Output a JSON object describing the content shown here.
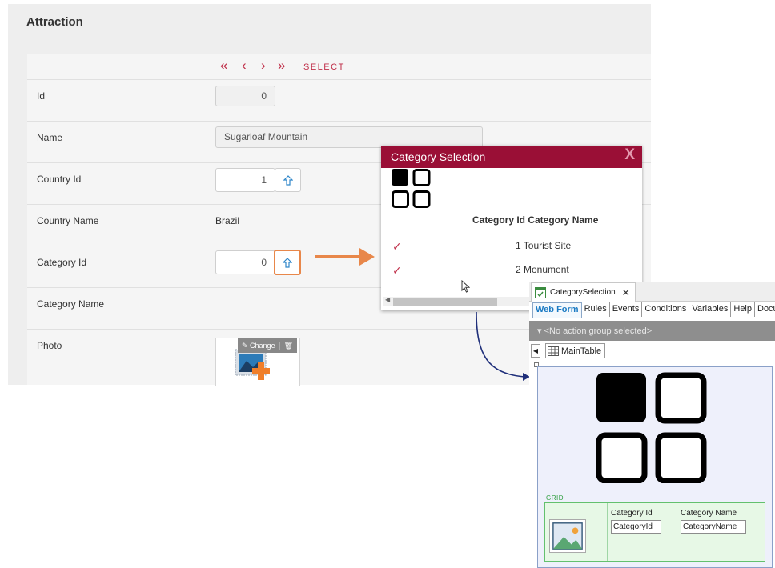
{
  "form": {
    "title": "Attraction",
    "nav": {
      "first": "«",
      "prev": "‹",
      "next": "›",
      "last": "»",
      "select": "SELECT"
    },
    "fields": {
      "id": {
        "label": "Id",
        "value": "0"
      },
      "name": {
        "label": "Name",
        "value": "Sugarloaf Mountain"
      },
      "country_id": {
        "label": "Country Id",
        "value": "1"
      },
      "country_name": {
        "label": "Country Name",
        "value": "Brazil"
      },
      "category_id": {
        "label": "Category Id",
        "value": "0"
      },
      "category_name": {
        "label": "Category Name",
        "value": ""
      },
      "photo": {
        "label": "Photo",
        "change_label": "✎ Change",
        "delete_label": "🗑"
      }
    }
  },
  "popup": {
    "title": "Category Selection",
    "close": "X",
    "column_header": "Category Id Category Name",
    "rows": [
      {
        "check": "✓",
        "value": "1 Tourist Site"
      },
      {
        "check": "✓",
        "value": "2 Monument"
      }
    ],
    "scroll_left": "◀"
  },
  "ide": {
    "tab": {
      "title": "CategorySelection",
      "close": "✕"
    },
    "subtabs": [
      "Web Form",
      "Rules",
      "Events",
      "Conditions",
      "Variables",
      "Help",
      "Docu"
    ],
    "action_group": "▾  <No action group selected>",
    "crumb_arrow": "◀",
    "crumb": "MainTable",
    "grid": {
      "label": "GRID",
      "columns": [
        {
          "header": "Category Id",
          "field": "CategoryId"
        },
        {
          "header": "Category Name",
          "field": "CategoryName"
        }
      ]
    }
  },
  "colors": {
    "accent": "#9a0f36",
    "nav": "#c0304a",
    "highlight": "#e8874a",
    "connector": "#1f2f7a",
    "grid_border": "#63c06e"
  },
  "icons": [
    "grid-four-icon",
    "arrow-up-icon",
    "check-icon",
    "image-placeholder-icon",
    "table-icon",
    "form-tab-icon",
    "mouse-cursor-icon"
  ]
}
